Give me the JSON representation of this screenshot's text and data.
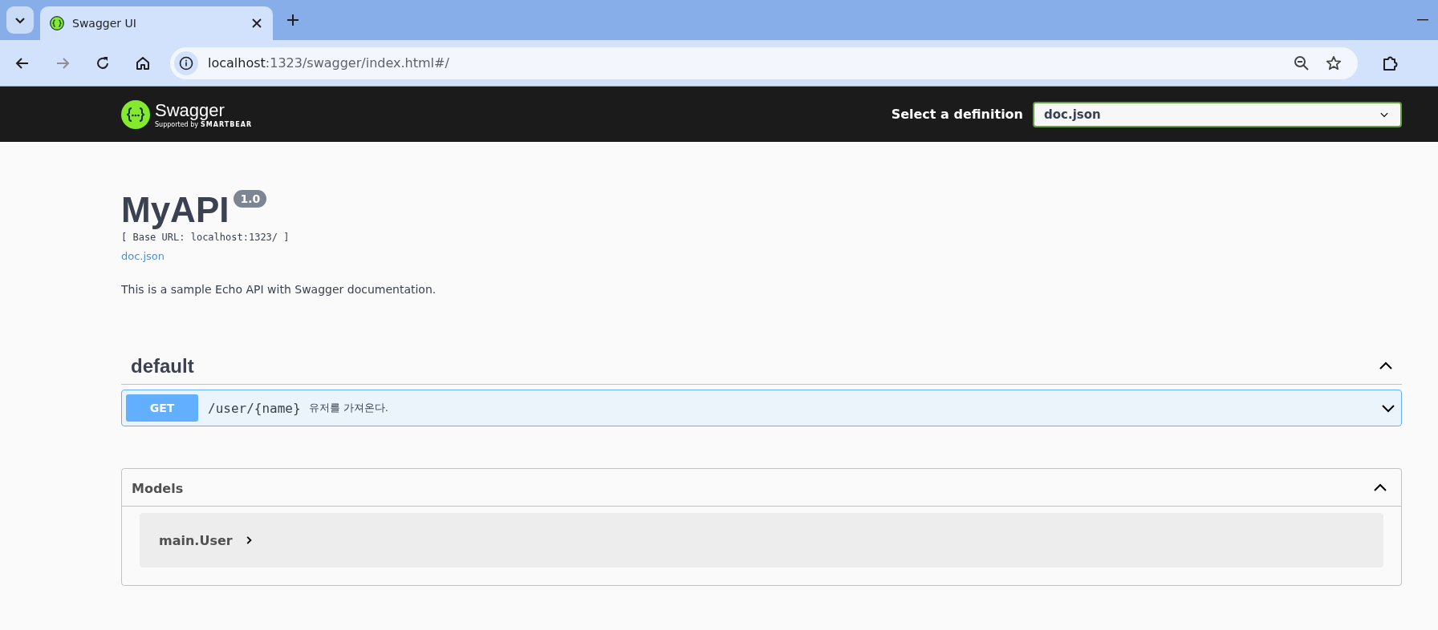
{
  "browser": {
    "tabs": [
      {
        "title": "Swagger UI",
        "selected": true
      }
    ],
    "nav": [
      {
        "kind": "back",
        "disabled": false
      },
      {
        "kind": "forward",
        "disabled": true
      },
      {
        "kind": "reload",
        "disabled": false
      },
      {
        "kind": "home",
        "disabled": false
      }
    ],
    "address": {
      "host": "localhost",
      "path": ":1323/swagger/index.html#/"
    }
  },
  "topbar": {
    "brand": "Swagger",
    "tagline": "Supported by",
    "company": "SMARTBEAR",
    "definition_label": "Select a definition",
    "definition_value": "doc.json"
  },
  "info": {
    "title": "MyAPI",
    "version": "1.0",
    "base_url": "[ Base URL: localhost:1323/ ]",
    "spec_link": "doc.json",
    "description": "This is a sample Echo API with Swagger documentation."
  },
  "sections": [
    {
      "name": "default",
      "expanded": true,
      "operations": [
        {
          "method": "GET",
          "path": "/user/{name}",
          "summary": "유저를 가져온다.",
          "expanded": false
        }
      ]
    }
  ],
  "models": {
    "title": "Models",
    "expanded": true,
    "items": [
      {
        "name": "main.User",
        "expanded": false
      }
    ]
  }
}
